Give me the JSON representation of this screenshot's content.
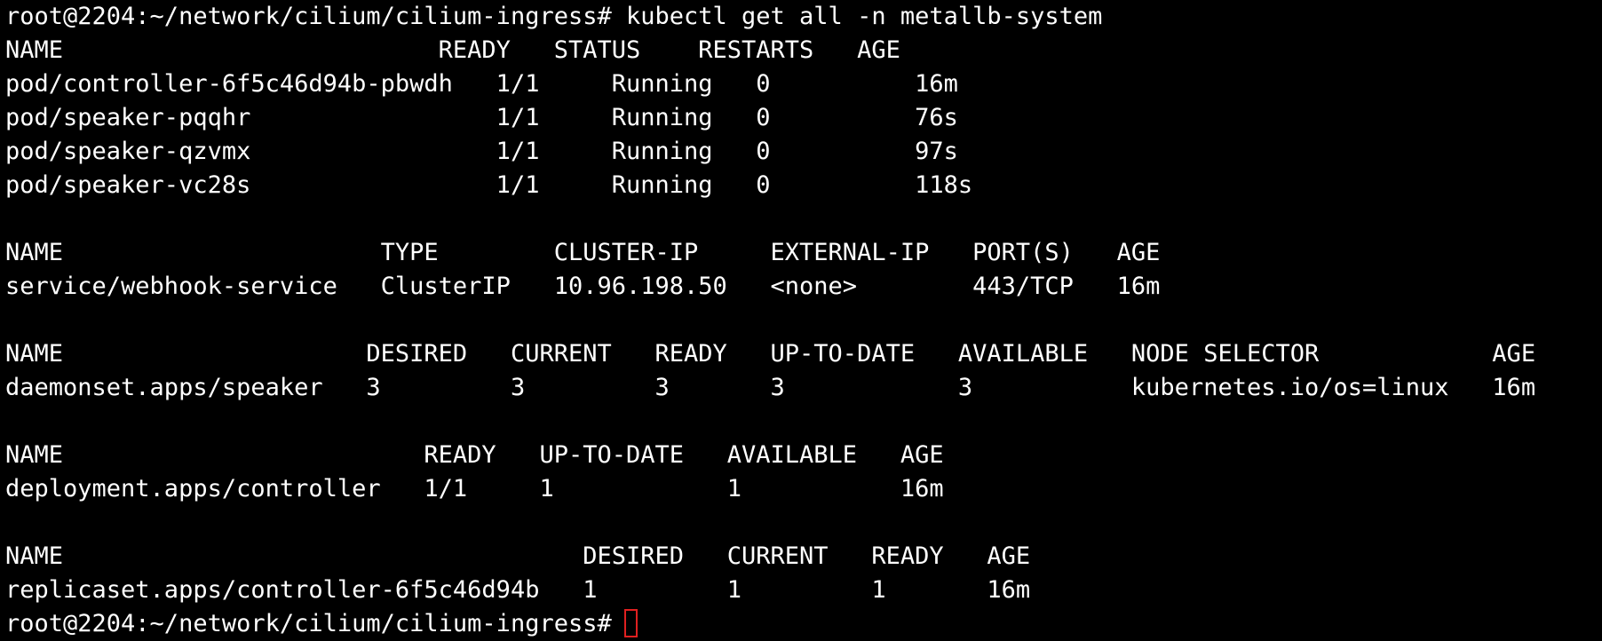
{
  "terminal": {
    "lines": [
      "root@2204:~/network/cilium/cilium-ingress# kubectl get all -n metallb-system",
      "NAME                          READY   STATUS    RESTARTS   AGE",
      "pod/controller-6f5c46d94b-pbwdh   1/1     Running   0          16m",
      "pod/speaker-pqqhr                 1/1     Running   0          76s",
      "pod/speaker-qzvmx                 1/1     Running   0          97s",
      "pod/speaker-vc28s                 1/1     Running   0          118s",
      "",
      "NAME                      TYPE        CLUSTER-IP     EXTERNAL-IP   PORT(S)   AGE",
      "service/webhook-service   ClusterIP   10.96.198.50   <none>        443/TCP   16m",
      "",
      "NAME                     DESIRED   CURRENT   READY   UP-TO-DATE   AVAILABLE   NODE SELECTOR            AGE",
      "daemonset.apps/speaker   3         3         3       3            3           kubernetes.io/os=linux   16m",
      "",
      "NAME                         READY   UP-TO-DATE   AVAILABLE   AGE",
      "deployment.apps/controller   1/1     1            1           16m",
      "",
      "NAME                                    DESIRED   CURRENT   READY   AGE",
      "replicaset.apps/controller-6f5c46d94b   1         1         1       16m"
    ],
    "prompt": "root@2204:~/network/cilium/cilium-ingress#",
    "cursor_color": "#e02020",
    "background_color": "#000000",
    "text_color": "#ffffff"
  }
}
